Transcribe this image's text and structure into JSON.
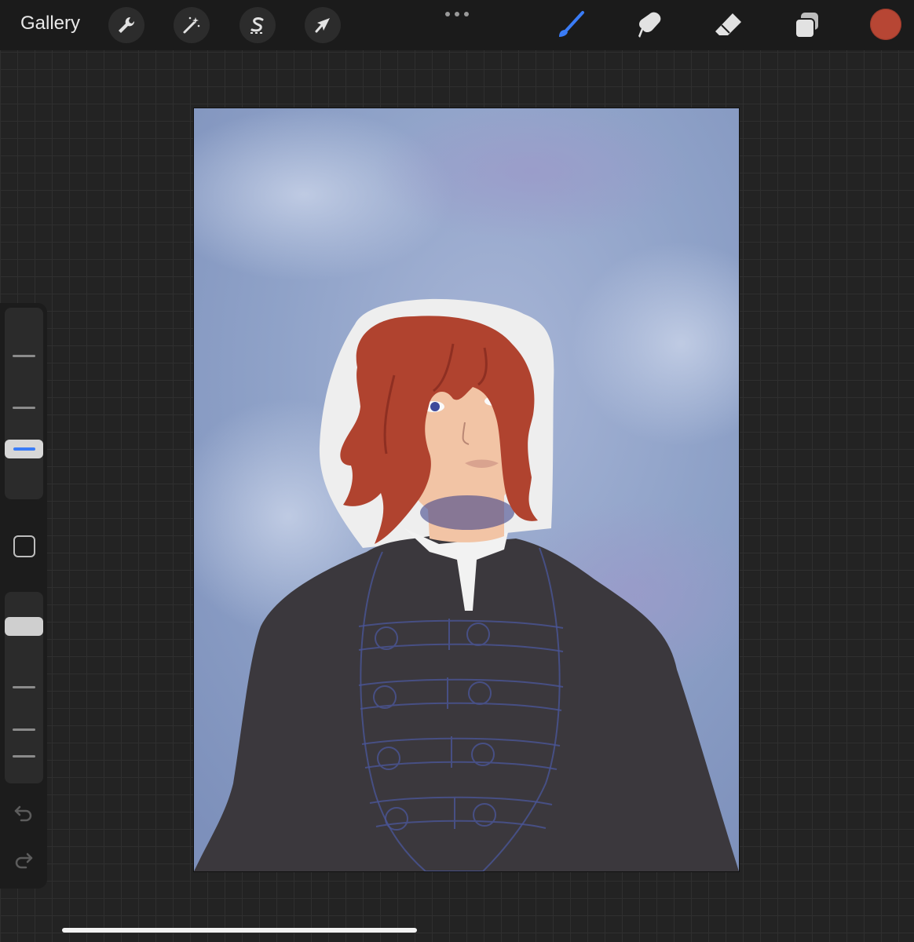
{
  "toolbar": {
    "gallery_label": "Gallery",
    "left_tools": [
      {
        "icon": "wrench-icon"
      },
      {
        "icon": "magic-wand-icon"
      },
      {
        "icon": "selection-s-icon"
      },
      {
        "icon": "transform-arrow-icon"
      }
    ],
    "more_icon": "more-dots-icon",
    "right_tools": [
      {
        "icon": "brush-icon",
        "active": true
      },
      {
        "icon": "smudge-icon"
      },
      {
        "icon": "eraser-icon"
      },
      {
        "icon": "layers-icon"
      }
    ],
    "current_color": "#b74634",
    "active_tool_color": "#3a7cf6"
  },
  "sidebar": {
    "brush_size_icon": "brush-size-slider",
    "opacity_icon": "opacity-slider",
    "modifier_icon": "square-modifier-icon",
    "undo_icon": "undo-icon",
    "redo_icon": "redo-icon"
  },
  "canvas": {
    "background_color": "#8fa2c8",
    "hair_color": "#b0432f",
    "coat_color": "#3b383d",
    "skin_color": "#f2c4a5"
  }
}
